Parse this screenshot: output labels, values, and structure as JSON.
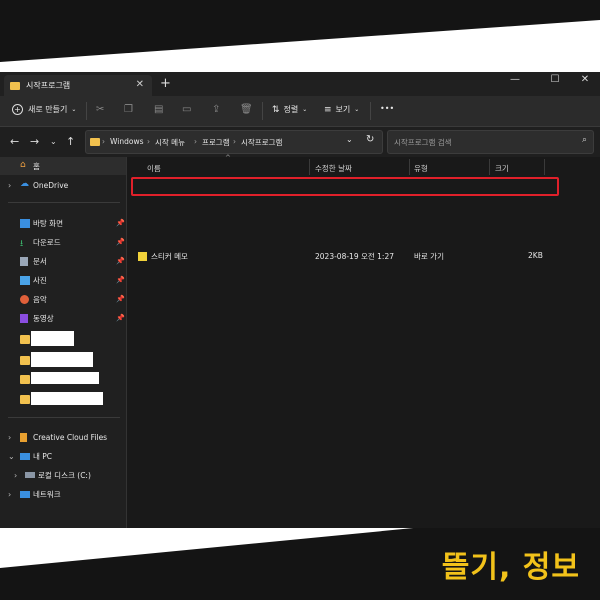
{
  "tab": {
    "title": "시작프로그램",
    "close": "✕",
    "new": "+"
  },
  "window_controls": {
    "minimize": "—",
    "maximize": "☐",
    "close": "✕"
  },
  "toolbar": {
    "new_label": "새로 만들기",
    "sort_label": "정렬",
    "view_label": "보기",
    "more": "•••"
  },
  "breadcrumb": [
    "Windows",
    "시작 메뉴",
    "프로그램",
    "시작프로그램"
  ],
  "search": {
    "placeholder": "시작프로그램 검색"
  },
  "sidebar": {
    "home": "홈",
    "onedrive": "OneDrive",
    "quick": [
      "바탕 화면",
      "다운로드",
      "문서",
      "사진",
      "음악",
      "동영상"
    ],
    "creative_cloud": "Creative Cloud Files",
    "this_pc": "내 PC",
    "local_disk": "로컬 디스크 (C:)",
    "network": "네트워크"
  },
  "columns": {
    "name": "이름",
    "modified": "수정한 날짜",
    "type": "유형",
    "size": "크기"
  },
  "files": [
    {
      "name": "스티커 메모",
      "modified": "2023-08-19 오전 1:27",
      "type": "바로 가기",
      "size": "2KB"
    }
  ],
  "brand": "뜰기, 정보",
  "colors": {
    "accent": "#f2c21a",
    "highlight": "#e0202a",
    "background": "#1c1c1c"
  }
}
